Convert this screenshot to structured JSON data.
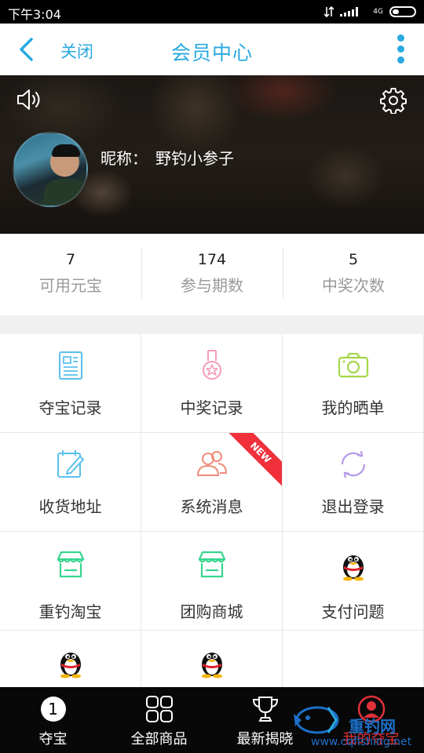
{
  "status_bar": {
    "time": "下午3:04",
    "network": "4G"
  },
  "titlebar": {
    "close_label": "关闭",
    "title": "会员中心"
  },
  "profile": {
    "nickname_label": "昵称：",
    "nickname": "野钓小参子"
  },
  "stats": [
    {
      "value": "7",
      "label": "可用元宝"
    },
    {
      "value": "174",
      "label": "参与期数"
    },
    {
      "value": "5",
      "label": "中奖次数"
    }
  ],
  "grid": [
    {
      "label": "夺宝记录",
      "icon": "document-icon",
      "color": "#5bc0eb"
    },
    {
      "label": "中奖记录",
      "icon": "medal-icon",
      "color": "#f59ab8"
    },
    {
      "label": "我的晒单",
      "icon": "camera-icon",
      "color": "#a5d64a"
    },
    {
      "label": "收货地址",
      "icon": "edit-calendar-icon",
      "color": "#5bc0eb"
    },
    {
      "label": "系统消息",
      "icon": "users-icon",
      "color": "#f08a7a",
      "badge": "NEW"
    },
    {
      "label": "退出登录",
      "icon": "refresh-icon",
      "color": "#b69ae8"
    },
    {
      "label": "重钓淘宝",
      "icon": "shop-icon",
      "color": "#36d68e"
    },
    {
      "label": "团购商城",
      "icon": "shop-icon",
      "color": "#36d68e"
    },
    {
      "label": "支付问题",
      "icon": "qq-icon",
      "color": "#000000"
    },
    {
      "label": "",
      "icon": "qq-icon",
      "color": "#000000"
    },
    {
      "label": "",
      "icon": "qq-icon",
      "color": "#000000"
    },
    {
      "label": "",
      "icon": "",
      "color": "#ffffff"
    }
  ],
  "bottom_nav": [
    {
      "label": "夺宝",
      "icon": "number-one-icon",
      "badge": "1"
    },
    {
      "label": "全部商品",
      "icon": "grid-icon"
    },
    {
      "label": "最新揭晓",
      "icon": "trophy-icon"
    },
    {
      "label": "我的夺宝",
      "icon": "user-icon",
      "active": true
    }
  ],
  "watermark": {
    "title": "重钓网",
    "url": "www.cqfishing.net"
  },
  "colors": {
    "accent": "#2aa9e0",
    "active_nav": "#e0303a",
    "new_badge": "#f0313c"
  }
}
